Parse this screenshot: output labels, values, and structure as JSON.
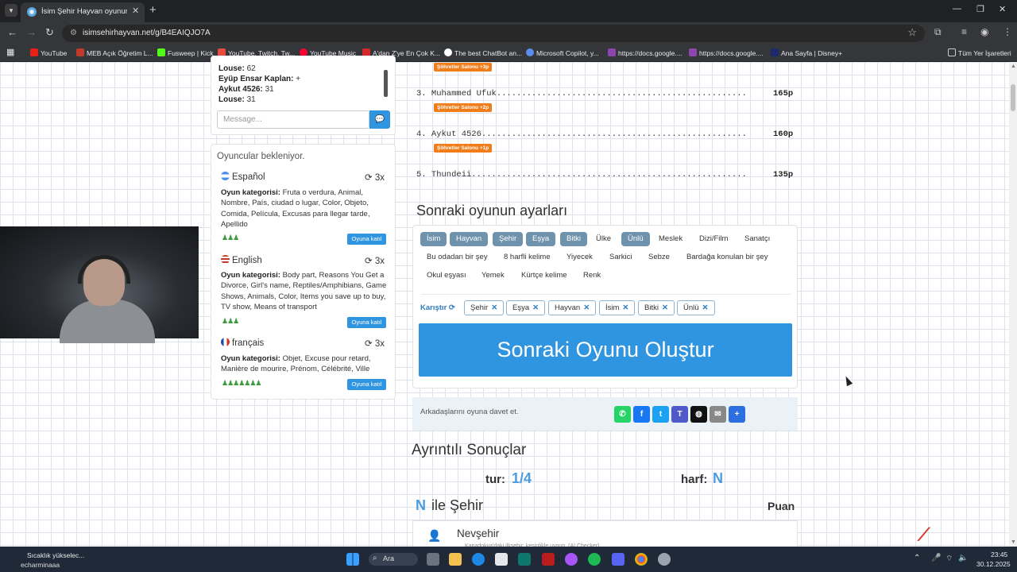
{
  "browser": {
    "tab_title": "İsim Şehir Hayvan oyununa katıl",
    "url": "isimsehirhayvan.net/g/B4EAIQJO7A",
    "bookmarks": [
      "YouTube",
      "MEB Açık Öğretim L...",
      "Fusweep | Kick",
      "YouTube, Twitch, Tw...",
      "YouTube Music",
      "A'dan Z'ye En Çok K...",
      "The best ChatBot an...",
      "Microsoft Copilot, y...",
      "https://docs.google....",
      "https://docs.google....",
      "Ana Sayfa | Disney+"
    ],
    "all_bookmarks": "Tüm Yer İşaretleri"
  },
  "chat": {
    "lines": [
      {
        "name": "Louse:",
        "text": "62"
      },
      {
        "name": "Eyüp Ensar Kaplan:",
        "text": "+"
      },
      {
        "name": "Aykut 4526:",
        "text": "31"
      },
      {
        "name": "Louse:",
        "text": "31"
      }
    ],
    "placeholder": "Message..."
  },
  "waiting": {
    "title": "Oyuncular bekleniyor.",
    "cat_label": "Oyun kategorisi:",
    "join_label": "Oyuna katıl",
    "rooms": [
      {
        "lang": "Español",
        "count": "3x",
        "cats": "Fruta o verdura, Animal, Nombre, País, ciudad o lugar, Color, Objeto, Comida, Película, Excusas para llegar tarde, Apellido",
        "players": "♟♟♟"
      },
      {
        "lang": "English",
        "count": "3x",
        "cats": "Body part, Reasons You Get a Divorce, Girl's name, Reptiles/Amphibians, Game Shows, Animals, Color, Items you save up to buy, TV show, Means of transport",
        "players": "♟♟♟"
      },
      {
        "lang": "français",
        "count": "3x",
        "cats": "Objet, Excuse pour retard, Manière de mourire, Prénom, Célébrité, Ville",
        "players": "♟♟♟♟♟♟♟"
      }
    ]
  },
  "ranking": [
    {
      "line": "3. Muhammed Ufuk..................................................",
      "pts": "165p",
      "badge": "Şöhretler Salonu +2p"
    },
    {
      "line": "4. Aykut 4526.....................................................",
      "pts": "160p",
      "badge": "Şöhretler Salonu +1p"
    },
    {
      "line": "5. Thundeii.......................................................",
      "pts": "135p",
      "badge": ""
    }
  ],
  "top_badge": "Şöhretler Salonu +3p",
  "settings": {
    "title": "Sonraki oyunun ayarları",
    "chips": [
      {
        "t": "İsim",
        "on": true
      },
      {
        "t": "Hayvan",
        "on": true
      },
      {
        "t": "Şehir",
        "on": true
      },
      {
        "t": "Eşya",
        "on": true
      },
      {
        "t": "Bitki",
        "on": true
      },
      {
        "t": "Ülke",
        "on": false
      },
      {
        "t": "Ünlü",
        "on": true
      },
      {
        "t": "Meslek",
        "on": false
      },
      {
        "t": "Dizi/Film",
        "on": false
      },
      {
        "t": "Sanatçı",
        "on": false
      },
      {
        "t": "Bu odadan bir şey",
        "on": false
      },
      {
        "t": "8 harfli kelime",
        "on": false
      },
      {
        "t": "Yiyecek",
        "on": false
      },
      {
        "t": "Sarkici",
        "on": false
      },
      {
        "t": "Sebze",
        "on": false
      },
      {
        "t": "Bardağa konulan bir şey",
        "on": false
      },
      {
        "t": "Okul eşyası",
        "on": false
      },
      {
        "t": "Yemek",
        "on": false
      },
      {
        "t": "Kürtçe kelime",
        "on": false
      },
      {
        "t": "Renk",
        "on": false
      }
    ],
    "shuffle": "Karıştır",
    "selected": [
      "Şehir",
      "Eşya",
      "Hayvan",
      "İsim",
      "Bitki",
      "Ünlü"
    ],
    "create_button": "Sonraki Oyunu Oluştur"
  },
  "invite": {
    "text": "Arkadaşlarını oyuna davet et."
  },
  "share_icons": [
    {
      "name": "whatsapp",
      "color": "#25d366",
      "g": "✆"
    },
    {
      "name": "facebook",
      "color": "#1877f2",
      "g": "f"
    },
    {
      "name": "twitter",
      "color": "#1da1f2",
      "g": "t"
    },
    {
      "name": "teams",
      "color": "#5059c9",
      "g": "T"
    },
    {
      "name": "snapchat",
      "color": "#111111",
      "g": "◍"
    },
    {
      "name": "email",
      "color": "#888888",
      "g": "✉"
    },
    {
      "name": "share",
      "color": "#2d6fe0",
      "g": "+"
    }
  ],
  "results": {
    "title": "Ayrıntılı Sonuçlar",
    "tur_label": "tur:",
    "tur": "1/4",
    "harf_label": "harf:",
    "harf": "N",
    "letter": "N",
    "cat": "ile Şehir",
    "puan": "Puan",
    "first_answer": "Nevşehir",
    "first_note": "Kapadokya'daki ilkşehir; kesinlikle uygun. (AI Checker)"
  },
  "taskbar": {
    "weather": "Sıcaklık yükselec...",
    "user": "echarminaaa",
    "search": "Ara",
    "time": "23:45",
    "date": "30.12.2025"
  }
}
